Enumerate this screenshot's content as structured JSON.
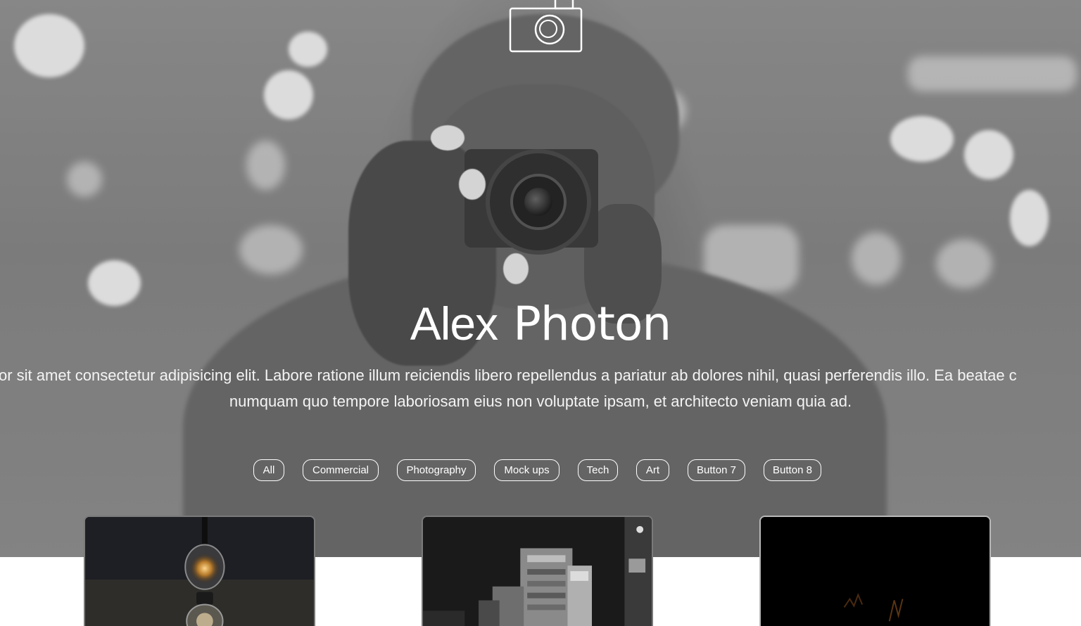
{
  "site": {
    "logo_icon": "camera-outline-icon",
    "title_light": "Alex",
    "title_bold": "Photon",
    "intro_line1": "or sit amet consectetur adipisicing elit. Labore ratione illum reiciendis libero repellendus a pariatur ab dolores nihil, quasi perferendis illo. Ea beatae c",
    "intro_line2": "numquam quo tempore laboriosam eius non voluptate ipsam, et architecto veniam quia ad."
  },
  "filters": [
    {
      "label": "All"
    },
    {
      "label": "Commercial"
    },
    {
      "label": "Photography"
    },
    {
      "label": "Mock ups"
    },
    {
      "label": "Tech"
    },
    {
      "label": "Art"
    },
    {
      "label": "Button 7"
    },
    {
      "label": "Button 8"
    }
  ],
  "gallery": [
    {
      "subject": "light-bulb-photo"
    },
    {
      "subject": "city-buildings-photo"
    },
    {
      "subject": "dark-photo"
    }
  ],
  "colors": {
    "hero_tint": "#808080",
    "text": "#ffffff",
    "page_bg": "#ffffff"
  }
}
